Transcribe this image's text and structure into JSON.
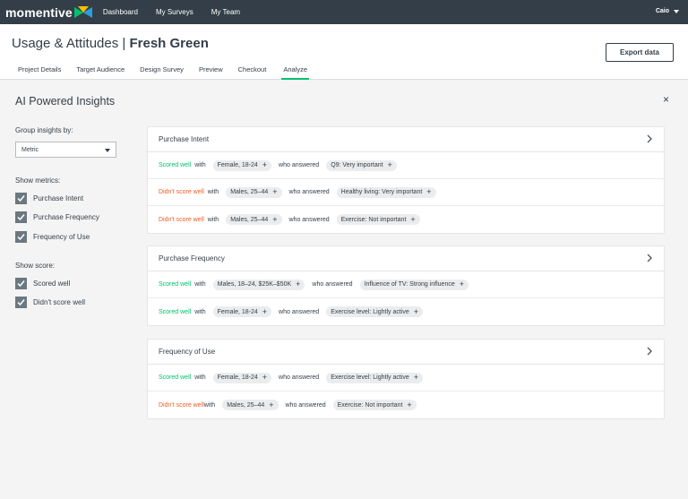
{
  "topbar": {
    "logo": "momentive",
    "nav": [
      "Dashboard",
      "My Surveys",
      "My Team"
    ],
    "user": "Caio"
  },
  "header": {
    "title_prefix": "Usage & Attitudes | ",
    "title_bold": "Fresh Green",
    "export_label": "Export data",
    "tabs": [
      "Project Details",
      "Target Audience",
      "Design Survey",
      "Preview",
      "Checkout",
      "Analyze"
    ],
    "active_tab": "Analyze"
  },
  "panel": {
    "title": "AI Powered Insights",
    "close_symbol": "×"
  },
  "sidebar": {
    "group_label": "Group insights by:",
    "group_value": "Metric",
    "metrics_label": "Show metrics:",
    "metrics": [
      "Purchase Intent",
      "Purchase Frequency",
      "Frequency of Use"
    ],
    "score_label": "Show score:",
    "scores": [
      "Scored well",
      "Didn't score well"
    ]
  },
  "phrases": {
    "with": "with",
    "who_answered": "who answered"
  },
  "colors": {
    "accent_green": "#00bf6f",
    "bad_orange": "#f05b24",
    "topbar": "#333e48"
  },
  "cards": [
    {
      "title": "Purchase Intent",
      "rows": [
        {
          "status": "Scored well",
          "segment": "Female, 18-24",
          "answer": "Q9: Very important"
        },
        {
          "status": "Didn't score well",
          "segment": "Males, 25–44",
          "answer": "Healthy living: Very important"
        },
        {
          "status": "Didn't score well",
          "segment": "Males, 25–44",
          "answer": "Exercise: Not important"
        }
      ]
    },
    {
      "title": "Purchase Frequency",
      "rows": [
        {
          "status": "Scored well",
          "segment": "Males, 18–24, $25K–$50K",
          "answer": "Influence of TV: Strong influence"
        },
        {
          "status": "Scored well",
          "segment": "Female, 18-24",
          "answer": "Exercise level: Lightly active"
        }
      ]
    },
    {
      "title": "Frequency of Use",
      "rows": [
        {
          "status": "Scored well",
          "segment": "Female, 18-24",
          "answer": "Exercise level: Lightly active"
        },
        {
          "status": "Didn't score well",
          "segment": "Males, 25–44",
          "answer": "Exercise: Not important"
        }
      ]
    }
  ]
}
